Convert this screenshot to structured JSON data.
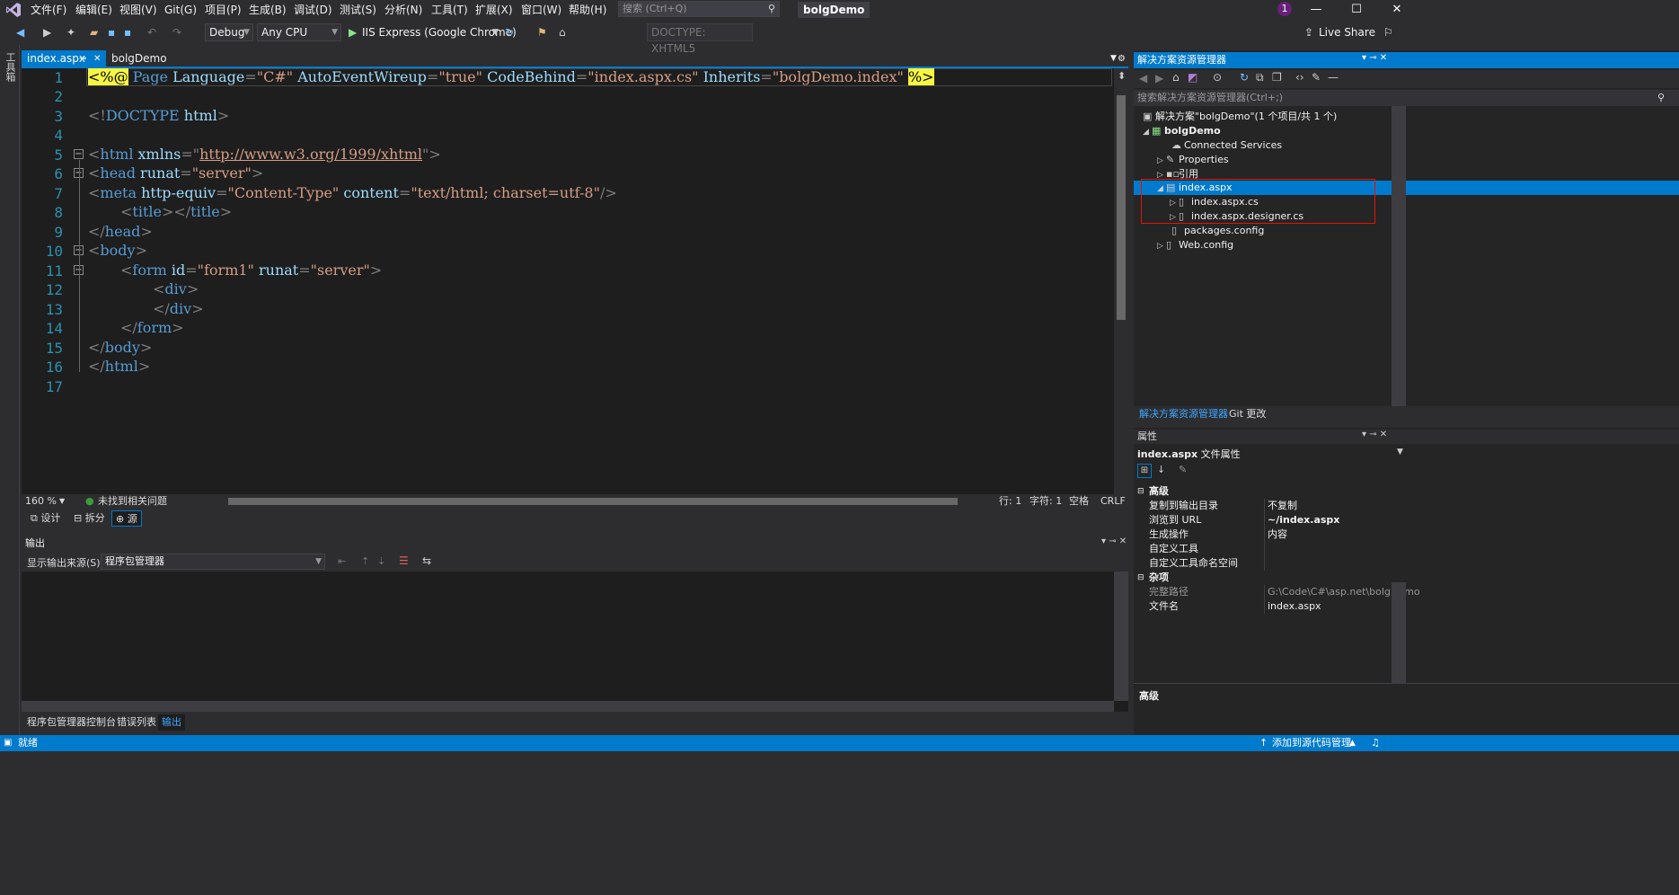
{
  "menu": [
    "文件(F)",
    "编辑(E)",
    "视图(V)",
    "Git(G)",
    "项目(P)",
    "生成(B)",
    "调试(D)",
    "测试(S)",
    "分析(N)",
    "工具(T)",
    "扩展(X)",
    "窗口(W)",
    "帮助(H)"
  ],
  "search_placeholder": "搜索 (Ctrl+Q)",
  "solution_name": "bolgDemo",
  "notification_count": "1",
  "live_share": "Live Share",
  "toolbar": {
    "config": "Debug",
    "platform": "Any CPU",
    "run": "IIS Express (Google Chrome)",
    "doctype": "DOCTYPE: XHTML5"
  },
  "toolbox_label": "工具箱",
  "doc_tabs": {
    "active": "index.aspx",
    "project": "bolgDemo"
  },
  "code_lines": [
    {
      "n": "1"
    },
    {
      "n": "2"
    },
    {
      "n": "3"
    },
    {
      "n": "4"
    },
    {
      "n": "5"
    },
    {
      "n": "6"
    },
    {
      "n": "7"
    },
    {
      "n": "8"
    },
    {
      "n": "9"
    },
    {
      "n": "10"
    },
    {
      "n": "11"
    },
    {
      "n": "12"
    },
    {
      "n": "13"
    },
    {
      "n": "14"
    },
    {
      "n": "15"
    },
    {
      "n": "16"
    },
    {
      "n": "17"
    }
  ],
  "code": {
    "l1_open": "<%",
    "l1_at": "@",
    "l1_page": " Page ",
    "l1_a1": "Language",
    "l1_v1": "\"C#\"",
    "l1_a2": "AutoEventWireup",
    "l1_v2": "\"true\"",
    "l1_a3": "CodeBehind",
    "l1_v3": "\"index.aspx.cs\"",
    "l1_a4": "Inherits",
    "l1_v4": "\"bolgDemo.index\"",
    "l1_close": "%>",
    "l3_doctype_open": "<!",
    "l3_doctype": "DOCTYPE",
    "l3_html": " html",
    "l3_close": ">",
    "l5_open": "<",
    "l5_tag": "html",
    "l5_attr": " xmlns",
    "l5_eq": "=\"",
    "l5_url": "http://www.w3.org/1999/xhtml",
    "l5_end": "\">",
    "l6_tag": "head",
    "l6_attr": " runat",
    "l6_val": "\"server\"",
    "l7_tag": "meta",
    "l7_a1": " http-equiv",
    "l7_v1": "\"Content-Type\"",
    "l7_a2": " content",
    "l7_v2": "\"text/html; charset=utf-8\"",
    "l8_tag": "title",
    "l9_tag": "head",
    "l10_tag": "body",
    "l11_tag": "form",
    "l11_a1": " id",
    "l11_v1": "\"form1\"",
    "l11_a2": " runat",
    "l11_v2": "\"server\"",
    "l12_tag": "div",
    "l13_tag": "div",
    "l14_tag": "form",
    "l15_tag": "body",
    "l16_tag": "html"
  },
  "editor_status": {
    "zoom": "160 %",
    "issues": "未找到相关问题",
    "line": "行: 1",
    "char": "字符: 1",
    "mode": "空格",
    "eol": "CRLF"
  },
  "view_buttons": [
    "设计",
    "拆分",
    "源"
  ],
  "output": {
    "title": "输出",
    "source_label": "显示输出来源(S):",
    "source_value": "程序包管理器"
  },
  "bottom_tabs": [
    "程序包管理器控制台",
    "错误列表",
    "输出"
  ],
  "status": {
    "ready": "就绪",
    "source_control": "添加到源代码管理"
  },
  "solution_explorer": {
    "title": "解决方案资源管理器",
    "search_placeholder": "搜索解决方案资源管理器(Ctrl+;)",
    "items": [
      {
        "label": "解决方案\"bolgDemo\"(1 个项目/共 1 个)"
      },
      {
        "label": "bolgDemo"
      },
      {
        "label": "Connected Services"
      },
      {
        "label": "Properties"
      },
      {
        "label": "引用"
      },
      {
        "label": "index.aspx"
      },
      {
        "label": "index.aspx.cs"
      },
      {
        "label": "index.aspx.designer.cs"
      },
      {
        "label": "packages.config"
      },
      {
        "label": "Web.config"
      }
    ],
    "tabs": [
      "解决方案资源管理器",
      "Git 更改"
    ]
  },
  "properties": {
    "title": "属性",
    "object": "index.aspx",
    "object_type": "文件属性",
    "categories": [
      {
        "name": "高级",
        "rows": [
          {
            "key": "复制到输出目录",
            "value": "不复制"
          },
          {
            "key": "浏览到 URL",
            "value": "~/index.aspx"
          },
          {
            "key": "生成操作",
            "value": "内容"
          },
          {
            "key": "自定义工具",
            "value": ""
          },
          {
            "key": "自定义工具命名空间",
            "value": ""
          }
        ]
      },
      {
        "name": "杂项",
        "rows": [
          {
            "key": "完整路径",
            "value": "G:\\Code\\C#\\asp.net\\bolgDemo"
          },
          {
            "key": "文件名",
            "value": "index.aspx"
          }
        ]
      }
    ],
    "description_title": "高级"
  }
}
